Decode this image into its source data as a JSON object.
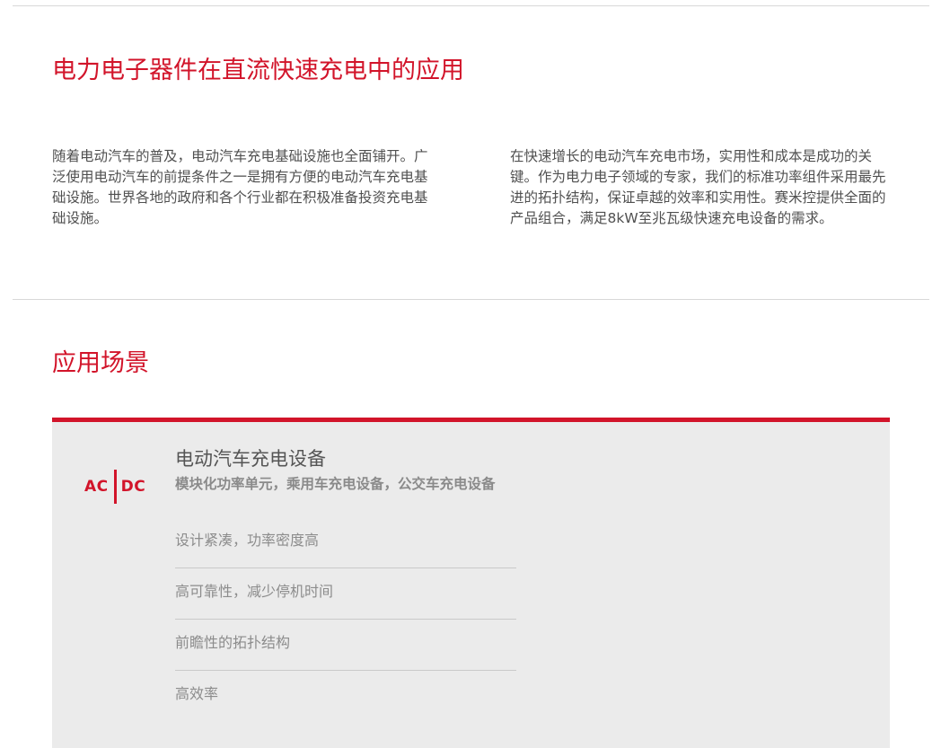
{
  "section1": {
    "title": "电力电子器件在直流快速充电中的应用",
    "intro_left": "随着电动汽车的普及，电动汽车充电基础设施也全面铺开。广泛使用电动汽车的前提条件之一是拥有方便的电动汽车充电基础设施。世界各地的政府和各个行业都在积极准备投资充电基础设施。",
    "intro_right": "在快速增长的电动汽车充电市场，实用性和成本是成功的关键。作为电力电子领域的专家，我们的标准功率组件采用最先进的拓扑结构，保证卓越的效率和实用性。赛米控提供全面的产品组合，满足8kW至兆瓦级快速充电设备的需求。"
  },
  "section2": {
    "title": "应用场景",
    "card": {
      "logo": {
        "left_text": "AC",
        "right_text": "DC",
        "icon": "ac-dc-icon"
      },
      "title": "电动汽车充电设备",
      "subtitle": "模块化功率单元，乘用车充电设备，公交车充电设备",
      "features": [
        "设计紧凑，功率密度高",
        "高可靠性，减少停机时间",
        "前瞻性的拓扑结构",
        "高效率"
      ]
    }
  },
  "colors": {
    "accent": "#d2142a",
    "card_background": "#ebebeb",
    "divider": "#d8d8d8"
  }
}
